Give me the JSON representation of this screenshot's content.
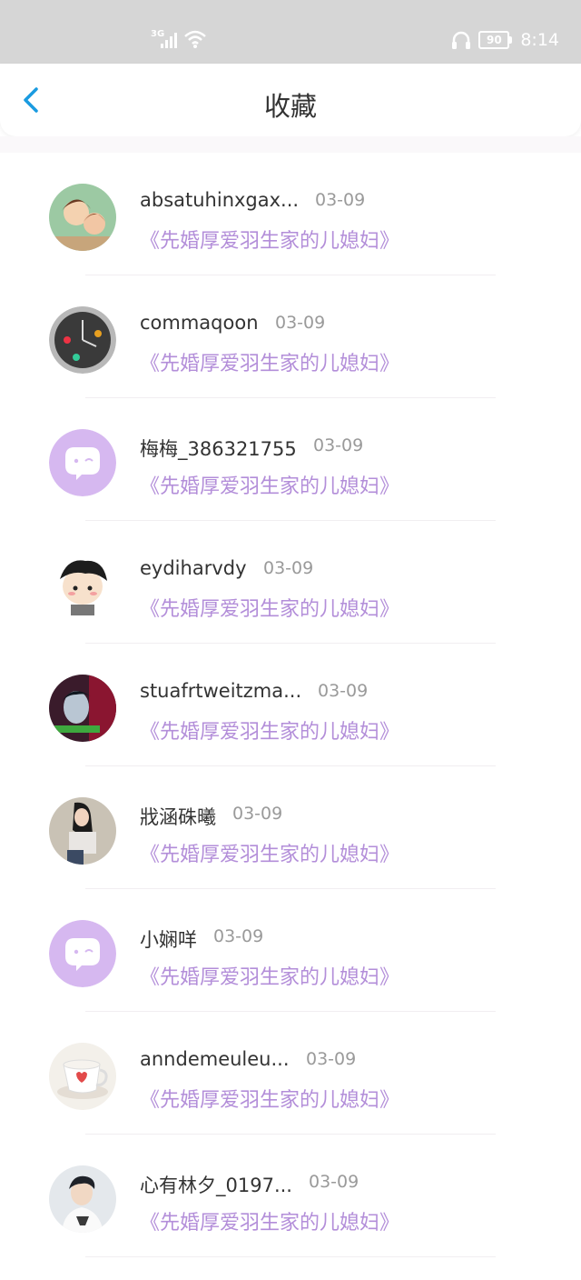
{
  "status_bar": {
    "network": "3G",
    "battery": "90",
    "time": "8:14"
  },
  "header": {
    "title": "收藏"
  },
  "colors": {
    "accent": "#1a9be0",
    "book_title": "#b38ed9",
    "default_avatar": "#d6b8f0"
  },
  "items": [
    {
      "name": "absatuhinxgax...",
      "date": "03-09",
      "book": "《先婚厚爱羽生家的儿媳妇》",
      "avatar": "anime-couple-avatar"
    },
    {
      "name": "commaqoon",
      "date": "03-09",
      "book": "《先婚厚爱羽生家的儿媳妇》",
      "avatar": "clock-avatar"
    },
    {
      "name": "梅梅_386321755",
      "date": "03-09",
      "book": "《先婚厚爱羽生家的儿媳妇》",
      "avatar": "default-chat-avatar"
    },
    {
      "name": "eydiharvdy",
      "date": "03-09",
      "book": "《先婚厚爱羽生家的儿媳妇》",
      "avatar": "cartoon-boy-avatar"
    },
    {
      "name": "stuafrtweitzma...",
      "date": "03-09",
      "book": "《先婚厚爱羽生家的儿媳妇》",
      "avatar": "photo-avatar"
    },
    {
      "name": "戕涵硃曦",
      "date": "03-09",
      "book": "《先婚厚爱羽生家的儿媳妇》",
      "avatar": "girl-photo-avatar"
    },
    {
      "name": "小娴咩",
      "date": "03-09",
      "book": "《先婚厚爱羽生家的儿媳妇》",
      "avatar": "default-chat-avatar"
    },
    {
      "name": "anndemeuleu...",
      "date": "03-09",
      "book": "《先婚厚爱羽生家的儿媳妇》",
      "avatar": "teacup-avatar"
    },
    {
      "name": "心有林夕_0197...",
      "date": "03-09",
      "book": "《先婚厚爱羽生家的儿媳妇》",
      "avatar": "boy-photo-avatar"
    }
  ]
}
